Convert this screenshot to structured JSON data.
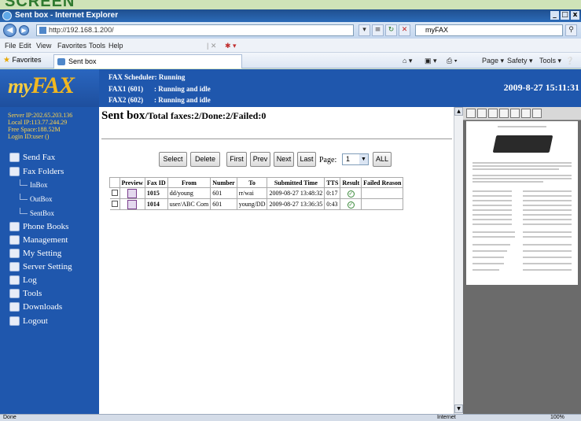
{
  "banner": {
    "text": "SCREEN"
  },
  "window": {
    "title": "Sent box - Internet Explorer"
  },
  "address": {
    "url": "http://192.168.1.200/",
    "search": "myFAX"
  },
  "menu": [
    "File",
    "Edit",
    "View",
    "Favorites",
    "Tools",
    "Help"
  ],
  "favorites": {
    "label": "Favorites",
    "tab": "Sent box"
  },
  "commands": {
    "page": "Page ▾",
    "safety": "Safety ▾",
    "tools": "Tools ▾"
  },
  "logo": {
    "my": "my",
    "fax": "FAX"
  },
  "server_info": {
    "server_ip": "Server IP:202.65.203.136",
    "local_ip": "Local IP:113.77.244.29",
    "free_space": "Free Space:188.52M",
    "login_id": "Login ID:user ()"
  },
  "nav": {
    "send_fax": "Send Fax",
    "fax_folders": "Fax Folders",
    "inbox": "InBox",
    "outbox": "OutBox",
    "sentbox": "SentBox",
    "phone_books": "Phone Books",
    "management": "Management",
    "my_setting": "My Setting",
    "server_setting": "Server Setting",
    "log": "Log",
    "tools": "Tools",
    "downloads": "Downloads",
    "logout": "Logout"
  },
  "header": {
    "scheduler": "FAX Scheduler: Running",
    "fax1_label": "FAX1 (601)",
    "fax1_status": ": Running and idle",
    "fax2_label": "FAX2 (602)",
    "fax2_status": ": Running and idle",
    "clock": "2009-8-27 15:11:31"
  },
  "page": {
    "title": "Sent box",
    "summary": "/Total faxes:2/Done:2/Failed:0"
  },
  "toolbar": {
    "select": "Select",
    "delete": "Delete",
    "first": "First",
    "prev": "Prev",
    "next": "Next",
    "last": "Last",
    "page_label": "Page:",
    "page_value": "1",
    "all": "ALL"
  },
  "table": {
    "columns": [
      "",
      "Preview",
      "Fax ID",
      "From",
      "Number",
      "To",
      "Submitted Time",
      "TTS",
      "Result",
      "Failed Reason"
    ],
    "rows": [
      {
        "fax_id": "1015",
        "from": "dd/young",
        "number": "601",
        "to": "rr/wai",
        "submitted": "2009-08-27 13:48:32",
        "tts": "0:17",
        "failed_reason": ""
      },
      {
        "fax_id": "1014",
        "from": "user/ABC Com",
        "number": "601",
        "to": "young/DD",
        "submitted": "2009-08-27 13:36:35",
        "tts": "0:43",
        "failed_reason": ""
      }
    ]
  },
  "statusbar": {
    "left": "Done",
    "zone": "Internet",
    "zoom": "100%"
  }
}
